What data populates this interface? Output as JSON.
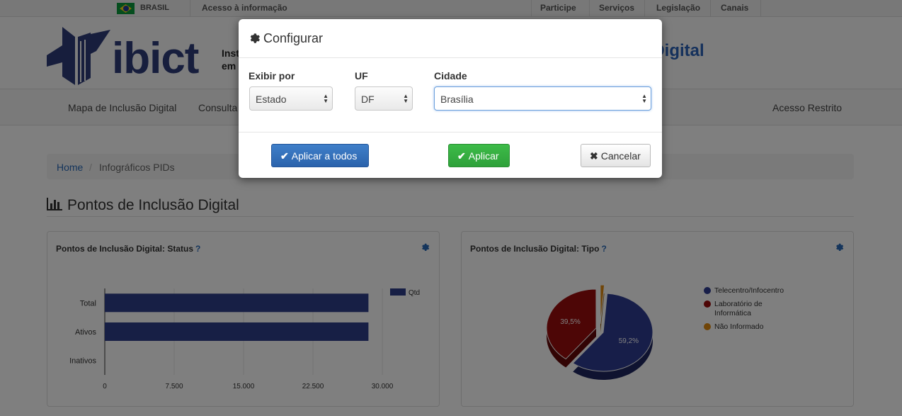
{
  "govbar": {
    "country": "BRASIL",
    "access_info": "Acesso à informação",
    "links": [
      "Participe",
      "Serviços",
      "Legislação",
      "Canais"
    ]
  },
  "header": {
    "logo_text": "ibict",
    "institute_text": "Inst em",
    "site_title_partial": "o Digital"
  },
  "nav": {
    "items": [
      "Mapa de Inclusão Digital",
      "Consulta",
      "Acesso Restrito"
    ]
  },
  "breadcrumb": {
    "home": "Home",
    "separator": "/",
    "current": "Infográficos PIDs"
  },
  "section": {
    "title": "Pontos de Inclusão Digital"
  },
  "panels": {
    "status": {
      "title": "Pontos de Inclusão Digital: Status",
      "help": "?"
    },
    "tipo": {
      "title": "Pontos de Inclusão Digital: Tipo",
      "help": "?"
    }
  },
  "chart_data": [
    {
      "type": "bar",
      "orientation": "horizontal",
      "categories": [
        "Total",
        "Ativos",
        "Inativos"
      ],
      "series": [
        {
          "name": "Qtd",
          "values": [
            28500,
            28500,
            0
          ]
        }
      ],
      "xlim": [
        0,
        30000
      ],
      "xticks": [
        "0",
        "7.500",
        "15.000",
        "22.500",
        "30.000"
      ],
      "legend": "top-right",
      "color": "#2e3e8a"
    },
    {
      "type": "pie",
      "labels": [
        "Telecentro/Infocentro",
        "Laboratório de Informática",
        "Não Informado"
      ],
      "values": [
        59.2,
        39.5,
        1.3
      ],
      "data_labels": [
        "59,2%",
        "39,5%",
        ""
      ],
      "colors": [
        "#2f3c93",
        "#9a0d0d",
        "#e08a10"
      ],
      "legend": "right"
    }
  ],
  "modal": {
    "title": "Configurar",
    "labels": {
      "exibir": "Exibir por",
      "uf": "UF",
      "cidade": "Cidade"
    },
    "values": {
      "exibir": "Estado",
      "uf": "DF",
      "cidade": "Brasília"
    },
    "buttons": {
      "apply_all": "Aplicar a todos",
      "apply": "Aplicar",
      "cancel": "Cancelar"
    }
  }
}
